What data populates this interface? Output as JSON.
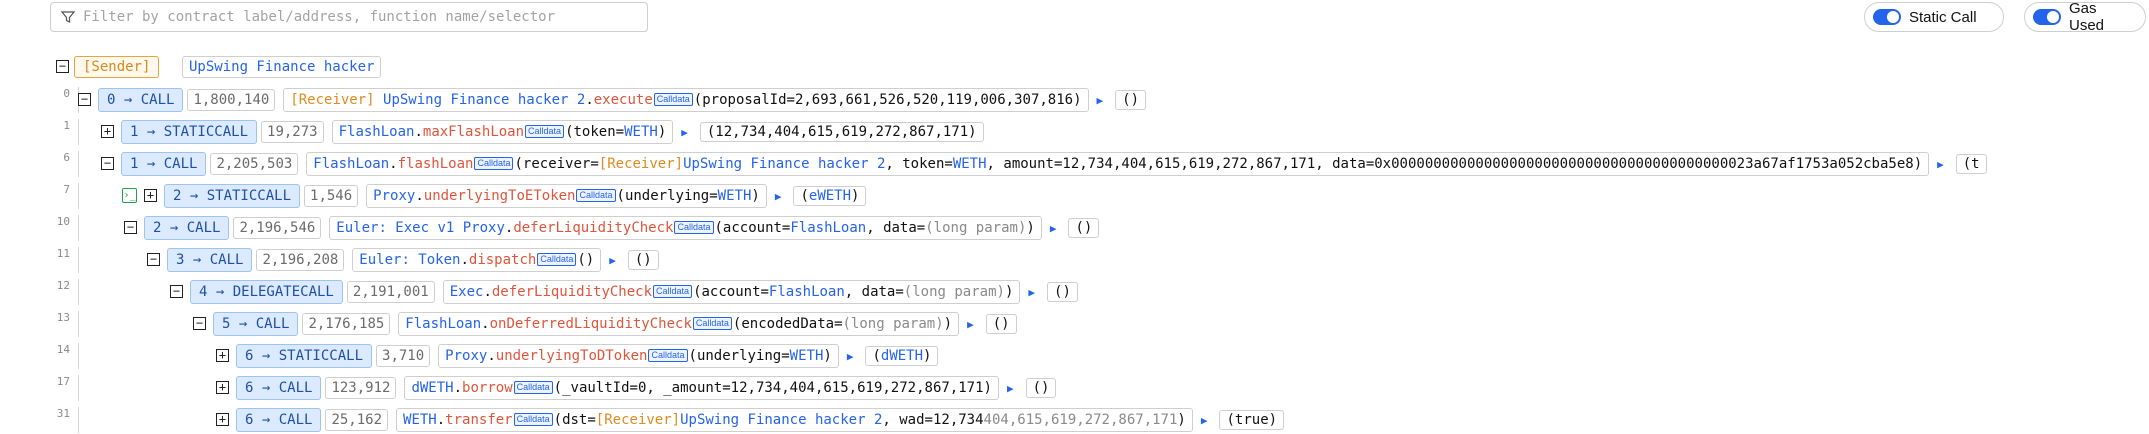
{
  "filter": {
    "placeholder": "Filter by contract label/address, function name/selector"
  },
  "toggles": {
    "static_call": "Static Call",
    "gas_used": "Gas Used"
  },
  "sender": {
    "tag": "[Sender]",
    "name": "UpSwing Finance hacker"
  },
  "badges": {
    "calldata": "Calldata"
  },
  "colors": {
    "accent": "#2563eb",
    "method": "#e0553b",
    "receiver": "#e08b1f",
    "call_bg": "#dbeafe"
  },
  "trace": [
    {
      "line": "0",
      "expand": "−",
      "call": "0 → CALL",
      "gas": "1,800,140",
      "parts": [
        [
          "o",
          "[Receiver] "
        ],
        [
          "b",
          "UpSwing Finance hacker 2"
        ],
        [
          "k",
          "."
        ],
        [
          "r",
          "execute"
        ],
        [
          "cd",
          ""
        ],
        [
          "k",
          "(proposalId=2,693,661,526,520,119,006,307,816)"
        ]
      ],
      "ret": [
        [
          "k",
          "()"
        ]
      ]
    },
    {
      "line": "1",
      "expand": "+",
      "call": "1 → STATICCALL",
      "gas": "19,273",
      "parts": [
        [
          "b",
          "FlashLoan"
        ],
        [
          "k",
          "."
        ],
        [
          "r",
          "maxFlashLoan"
        ],
        [
          "cd",
          ""
        ],
        [
          "k",
          "(token="
        ],
        [
          "b",
          "WETH"
        ],
        [
          "k",
          ")"
        ]
      ],
      "ret": [
        [
          "k",
          "(12,734,404,615,619,272,867,171)"
        ]
      ]
    },
    {
      "line": "6",
      "expand": "−",
      "call": "1 → CALL",
      "gas": "2,205,503",
      "parts": [
        [
          "b",
          "FlashLoan"
        ],
        [
          "k",
          "."
        ],
        [
          "r",
          "flashLoan"
        ],
        [
          "cd",
          ""
        ],
        [
          "k",
          "(receiver="
        ],
        [
          "o",
          "[Receiver]"
        ],
        [
          "b",
          "UpSwing Finance hacker 2"
        ],
        [
          "k",
          ", token="
        ],
        [
          "b",
          "WETH"
        ],
        [
          "k",
          ", amount=12,734,404,615,619,272,867,171, data=0x0000000000000000000000000000000000000000023a67af1753a052cba5e8)"
        ]
      ],
      "ret": [
        [
          "k",
          "(t"
        ]
      ]
    },
    {
      "line": "7",
      "expand": "+",
      "term": "›_",
      "call": "2 → STATICCALL",
      "gas": "1,546",
      "parts": [
        [
          "b",
          "Proxy"
        ],
        [
          "k",
          "."
        ],
        [
          "r",
          "underlyingToEToken"
        ],
        [
          "cd",
          ""
        ],
        [
          "k",
          "(underlying="
        ],
        [
          "b",
          "WETH"
        ],
        [
          "k",
          ")"
        ]
      ],
      "ret": [
        [
          "k",
          "("
        ],
        [
          "b",
          "eWETH"
        ],
        [
          "k",
          ")"
        ]
      ]
    },
    {
      "line": "10",
      "expand": "−",
      "call": "2 → CALL",
      "gas": "2,196,546",
      "parts": [
        [
          "b",
          "Euler: Exec v1 Proxy"
        ],
        [
          "k",
          "."
        ],
        [
          "r",
          "deferLiquidityCheck"
        ],
        [
          "cd",
          ""
        ],
        [
          "k",
          "(account="
        ],
        [
          "b",
          "FlashLoan"
        ],
        [
          "k",
          ", data="
        ],
        [
          "g",
          "(long param)"
        ],
        [
          "k",
          ")"
        ]
      ],
      "ret": [
        [
          "k",
          "()"
        ]
      ]
    },
    {
      "line": "11",
      "expand": "−",
      "call": "3 → CALL",
      "gas": "2,196,208",
      "parts": [
        [
          "b",
          "Euler: Token"
        ],
        [
          "k",
          "."
        ],
        [
          "r",
          "dispatch"
        ],
        [
          "cd",
          ""
        ],
        [
          "k",
          "()"
        ]
      ],
      "ret": [
        [
          "k",
          "()"
        ]
      ]
    },
    {
      "line": "12",
      "expand": "−",
      "call": "4 → DELEGATECALL",
      "gas": "2,191,001",
      "parts": [
        [
          "b",
          "Exec"
        ],
        [
          "k",
          "."
        ],
        [
          "r",
          "deferLiquidityCheck"
        ],
        [
          "cd",
          ""
        ],
        [
          "k",
          "(account="
        ],
        [
          "b",
          "FlashLoan"
        ],
        [
          "k",
          ", data="
        ],
        [
          "g",
          "(long param)"
        ],
        [
          "k",
          ")"
        ]
      ],
      "ret": [
        [
          "k",
          "()"
        ]
      ]
    },
    {
      "line": "13",
      "expand": "−",
      "call": "5 → CALL",
      "gas": "2,176,185",
      "parts": [
        [
          "b",
          "FlashLoan"
        ],
        [
          "k",
          "."
        ],
        [
          "r",
          "onDeferredLiquidityCheck"
        ],
        [
          "cd",
          ""
        ],
        [
          "k",
          "(encodedData="
        ],
        [
          "g",
          "(long param)"
        ],
        [
          "k",
          ")"
        ]
      ],
      "ret": [
        [
          "k",
          "()"
        ]
      ]
    },
    {
      "line": "14",
      "expand": "+",
      "call": "6 → STATICCALL",
      "gas": "3,710",
      "parts": [
        [
          "b",
          "Proxy"
        ],
        [
          "k",
          "."
        ],
        [
          "r",
          "underlyingToDToken"
        ],
        [
          "cd",
          ""
        ],
        [
          "k",
          "(underlying="
        ],
        [
          "b",
          "WETH"
        ],
        [
          "k",
          ")"
        ]
      ],
      "ret": [
        [
          "k",
          "("
        ],
        [
          "b",
          "dWETH"
        ],
        [
          "k",
          ")"
        ]
      ]
    },
    {
      "line": "17",
      "expand": "+",
      "call": "6 → CALL",
      "gas": "123,912",
      "parts": [
        [
          "b",
          "dWETH"
        ],
        [
          "k",
          "."
        ],
        [
          "r",
          "borrow"
        ],
        [
          "cd",
          ""
        ],
        [
          "k",
          "(_vaultId=0, _amount=12,734,404,615,619,272,867,171)"
        ]
      ],
      "ret": [
        [
          "k",
          "()"
        ]
      ]
    },
    {
      "line": "31",
      "expand": "+",
      "call": "6 → CALL",
      "gas": "25,162",
      "parts": [
        [
          "b",
          "WETH"
        ],
        [
          "k",
          "."
        ],
        [
          "r",
          "transfer"
        ],
        [
          "cd",
          ""
        ],
        [
          "k",
          "(dst="
        ],
        [
          "o",
          "[Receiver]"
        ],
        [
          "b",
          "UpSwing Finance hacker 2"
        ],
        [
          "k",
          ", wad=12,734"
        ],
        [
          "g",
          "404,615,619,272,867,171"
        ],
        [
          "k",
          ")"
        ]
      ],
      "ret": [
        [
          "k",
          "(true)"
        ]
      ]
    }
  ]
}
